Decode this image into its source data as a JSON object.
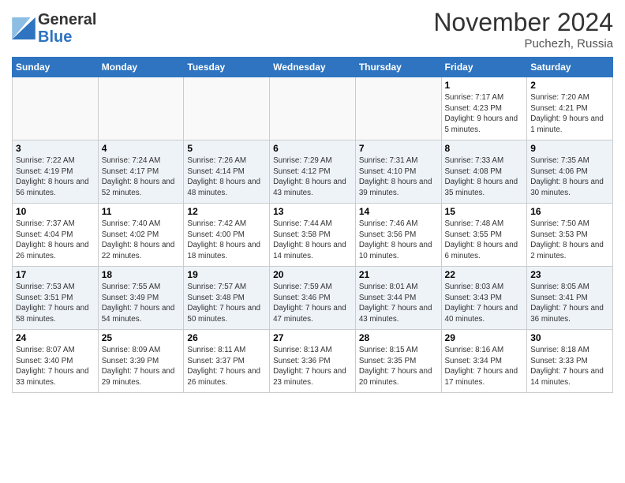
{
  "logo": {
    "general": "General",
    "blue": "Blue"
  },
  "title": "November 2024",
  "location": "Puchezh, Russia",
  "days_of_week": [
    "Sunday",
    "Monday",
    "Tuesday",
    "Wednesday",
    "Thursday",
    "Friday",
    "Saturday"
  ],
  "weeks": [
    [
      {
        "day": "",
        "sunrise": "",
        "sunset": "",
        "daylight": ""
      },
      {
        "day": "",
        "sunrise": "",
        "sunset": "",
        "daylight": ""
      },
      {
        "day": "",
        "sunrise": "",
        "sunset": "",
        "daylight": ""
      },
      {
        "day": "",
        "sunrise": "",
        "sunset": "",
        "daylight": ""
      },
      {
        "day": "",
        "sunrise": "",
        "sunset": "",
        "daylight": ""
      },
      {
        "day": "1",
        "sunrise": "Sunrise: 7:17 AM",
        "sunset": "Sunset: 4:23 PM",
        "daylight": "Daylight: 9 hours and 5 minutes."
      },
      {
        "day": "2",
        "sunrise": "Sunrise: 7:20 AM",
        "sunset": "Sunset: 4:21 PM",
        "daylight": "Daylight: 9 hours and 1 minute."
      }
    ],
    [
      {
        "day": "3",
        "sunrise": "Sunrise: 7:22 AM",
        "sunset": "Sunset: 4:19 PM",
        "daylight": "Daylight: 8 hours and 56 minutes."
      },
      {
        "day": "4",
        "sunrise": "Sunrise: 7:24 AM",
        "sunset": "Sunset: 4:17 PM",
        "daylight": "Daylight: 8 hours and 52 minutes."
      },
      {
        "day": "5",
        "sunrise": "Sunrise: 7:26 AM",
        "sunset": "Sunset: 4:14 PM",
        "daylight": "Daylight: 8 hours and 48 minutes."
      },
      {
        "day": "6",
        "sunrise": "Sunrise: 7:29 AM",
        "sunset": "Sunset: 4:12 PM",
        "daylight": "Daylight: 8 hours and 43 minutes."
      },
      {
        "day": "7",
        "sunrise": "Sunrise: 7:31 AM",
        "sunset": "Sunset: 4:10 PM",
        "daylight": "Daylight: 8 hours and 39 minutes."
      },
      {
        "day": "8",
        "sunrise": "Sunrise: 7:33 AM",
        "sunset": "Sunset: 4:08 PM",
        "daylight": "Daylight: 8 hours and 35 minutes."
      },
      {
        "day": "9",
        "sunrise": "Sunrise: 7:35 AM",
        "sunset": "Sunset: 4:06 PM",
        "daylight": "Daylight: 8 hours and 30 minutes."
      }
    ],
    [
      {
        "day": "10",
        "sunrise": "Sunrise: 7:37 AM",
        "sunset": "Sunset: 4:04 PM",
        "daylight": "Daylight: 8 hours and 26 minutes."
      },
      {
        "day": "11",
        "sunrise": "Sunrise: 7:40 AM",
        "sunset": "Sunset: 4:02 PM",
        "daylight": "Daylight: 8 hours and 22 minutes."
      },
      {
        "day": "12",
        "sunrise": "Sunrise: 7:42 AM",
        "sunset": "Sunset: 4:00 PM",
        "daylight": "Daylight: 8 hours and 18 minutes."
      },
      {
        "day": "13",
        "sunrise": "Sunrise: 7:44 AM",
        "sunset": "Sunset: 3:58 PM",
        "daylight": "Daylight: 8 hours and 14 minutes."
      },
      {
        "day": "14",
        "sunrise": "Sunrise: 7:46 AM",
        "sunset": "Sunset: 3:56 PM",
        "daylight": "Daylight: 8 hours and 10 minutes."
      },
      {
        "day": "15",
        "sunrise": "Sunrise: 7:48 AM",
        "sunset": "Sunset: 3:55 PM",
        "daylight": "Daylight: 8 hours and 6 minutes."
      },
      {
        "day": "16",
        "sunrise": "Sunrise: 7:50 AM",
        "sunset": "Sunset: 3:53 PM",
        "daylight": "Daylight: 8 hours and 2 minutes."
      }
    ],
    [
      {
        "day": "17",
        "sunrise": "Sunrise: 7:53 AM",
        "sunset": "Sunset: 3:51 PM",
        "daylight": "Daylight: 7 hours and 58 minutes."
      },
      {
        "day": "18",
        "sunrise": "Sunrise: 7:55 AM",
        "sunset": "Sunset: 3:49 PM",
        "daylight": "Daylight: 7 hours and 54 minutes."
      },
      {
        "day": "19",
        "sunrise": "Sunrise: 7:57 AM",
        "sunset": "Sunset: 3:48 PM",
        "daylight": "Daylight: 7 hours and 50 minutes."
      },
      {
        "day": "20",
        "sunrise": "Sunrise: 7:59 AM",
        "sunset": "Sunset: 3:46 PM",
        "daylight": "Daylight: 7 hours and 47 minutes."
      },
      {
        "day": "21",
        "sunrise": "Sunrise: 8:01 AM",
        "sunset": "Sunset: 3:44 PM",
        "daylight": "Daylight: 7 hours and 43 minutes."
      },
      {
        "day": "22",
        "sunrise": "Sunrise: 8:03 AM",
        "sunset": "Sunset: 3:43 PM",
        "daylight": "Daylight: 7 hours and 40 minutes."
      },
      {
        "day": "23",
        "sunrise": "Sunrise: 8:05 AM",
        "sunset": "Sunset: 3:41 PM",
        "daylight": "Daylight: 7 hours and 36 minutes."
      }
    ],
    [
      {
        "day": "24",
        "sunrise": "Sunrise: 8:07 AM",
        "sunset": "Sunset: 3:40 PM",
        "daylight": "Daylight: 7 hours and 33 minutes."
      },
      {
        "day": "25",
        "sunrise": "Sunrise: 8:09 AM",
        "sunset": "Sunset: 3:39 PM",
        "daylight": "Daylight: 7 hours and 29 minutes."
      },
      {
        "day": "26",
        "sunrise": "Sunrise: 8:11 AM",
        "sunset": "Sunset: 3:37 PM",
        "daylight": "Daylight: 7 hours and 26 minutes."
      },
      {
        "day": "27",
        "sunrise": "Sunrise: 8:13 AM",
        "sunset": "Sunset: 3:36 PM",
        "daylight": "Daylight: 7 hours and 23 minutes."
      },
      {
        "day": "28",
        "sunrise": "Sunrise: 8:15 AM",
        "sunset": "Sunset: 3:35 PM",
        "daylight": "Daylight: 7 hours and 20 minutes."
      },
      {
        "day": "29",
        "sunrise": "Sunrise: 8:16 AM",
        "sunset": "Sunset: 3:34 PM",
        "daylight": "Daylight: 7 hours and 17 minutes."
      },
      {
        "day": "30",
        "sunrise": "Sunrise: 8:18 AM",
        "sunset": "Sunset: 3:33 PM",
        "daylight": "Daylight: 7 hours and 14 minutes."
      }
    ]
  ]
}
